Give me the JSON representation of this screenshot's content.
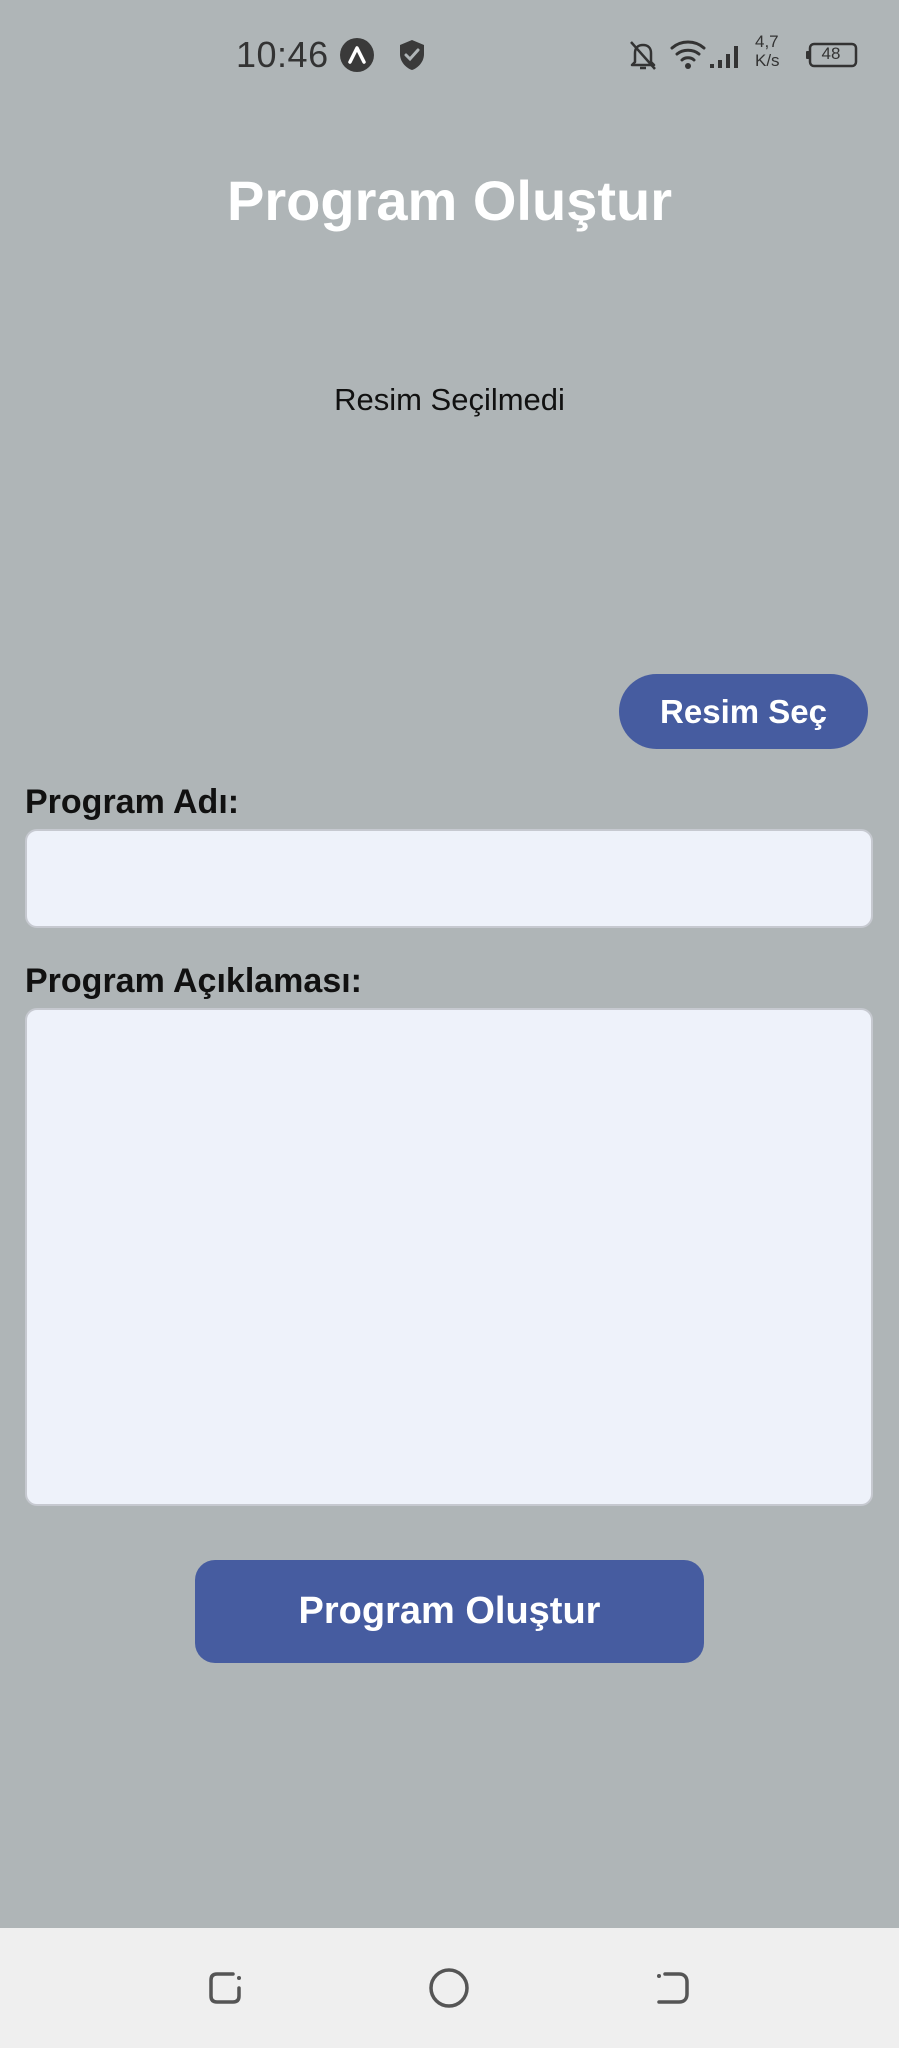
{
  "status_bar": {
    "time": "10:46",
    "net_speed_value": "4,7",
    "net_speed_unit": "K/s",
    "battery": "48",
    "icons": [
      "app-a-icon",
      "shield-icon",
      "bell-off-icon",
      "wifi-icon",
      "signal-icon",
      "battery-icon"
    ]
  },
  "page": {
    "title": "Program Oluştur",
    "image_status": "Resim Seçilmedi",
    "pick_image_label": "Resim Seç",
    "name_label": "Program Adı:",
    "name_value": "",
    "description_label": "Program Açıklaması:",
    "description_value": "",
    "submit_label": "Program Oluştur"
  },
  "nav_bar": {
    "icons": [
      "back-icon",
      "home-icon",
      "recents-icon"
    ]
  },
  "colors": {
    "background": "#afb5b7",
    "accent": "#465ca0",
    "input_background": "#eef2fa"
  }
}
